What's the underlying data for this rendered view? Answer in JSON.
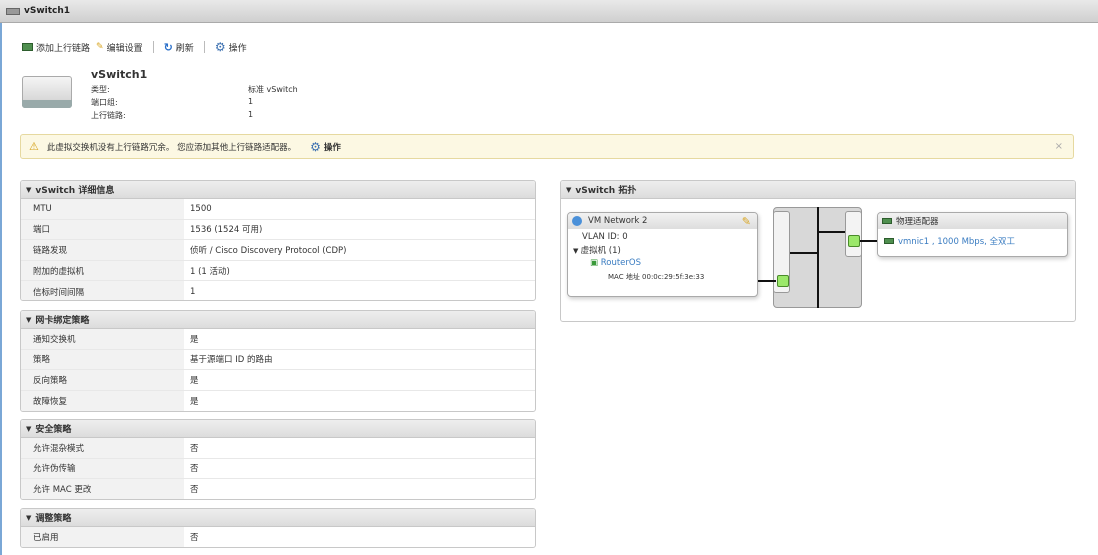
{
  "window": {
    "title": "vSwitch1"
  },
  "toolbar": {
    "add_uplink": "添加上行链路",
    "edit_settings": "编辑设置",
    "refresh": "刷新",
    "actions": "操作"
  },
  "header": {
    "name": "vSwitch1",
    "rows": [
      {
        "label": "类型:",
        "value": "标准 vSwitch"
      },
      {
        "label": "端口组:",
        "value": "1"
      },
      {
        "label": "上行链路:",
        "value": "1"
      }
    ]
  },
  "warning": {
    "text": "此虚拟交换机没有上行链路冗余。 您应添加其他上行链路适配器。",
    "action": "操作",
    "close": "×"
  },
  "panels": [
    {
      "title": "vSwitch 详细信息",
      "rows": [
        {
          "k": "MTU",
          "v": "1500"
        },
        {
          "k": "端口",
          "v": "1536 (1524 可用)"
        },
        {
          "k": "链路发现",
          "v": "侦听 / Cisco Discovery Protocol (CDP)"
        },
        {
          "k": "附加的虚拟机",
          "v": "1 (1 活动)"
        },
        {
          "k": "信标时间间隔",
          "v": "1"
        }
      ]
    },
    {
      "title": "网卡绑定策略",
      "rows": [
        {
          "k": "通知交换机",
          "v": "是"
        },
        {
          "k": "策略",
          "v": "基于源端口 ID 的路由"
        },
        {
          "k": "反向策略",
          "v": "是"
        },
        {
          "k": "故障恢复",
          "v": "是"
        }
      ]
    },
    {
      "title": "安全策略",
      "rows": [
        {
          "k": "允许混杂模式",
          "v": "否"
        },
        {
          "k": "允许伪传输",
          "v": "否"
        },
        {
          "k": "允许 MAC 更改",
          "v": "否"
        }
      ]
    },
    {
      "title": "调整策略",
      "rows": [
        {
          "k": "已启用",
          "v": "否"
        }
      ]
    }
  ],
  "topology": {
    "title": "vSwitch 拓扑",
    "portgroup": {
      "name": "VM Network 2",
      "vlan": "VLAN ID: 0",
      "vms_label": "虚拟机 (1)",
      "vm": "RouterOS",
      "mac": "MAC 地址 00:0c:29:5f:3e:33"
    },
    "physical": {
      "title": "物理适配器",
      "nic": "vmnic1 , 1000 Mbps, 全双工"
    }
  }
}
